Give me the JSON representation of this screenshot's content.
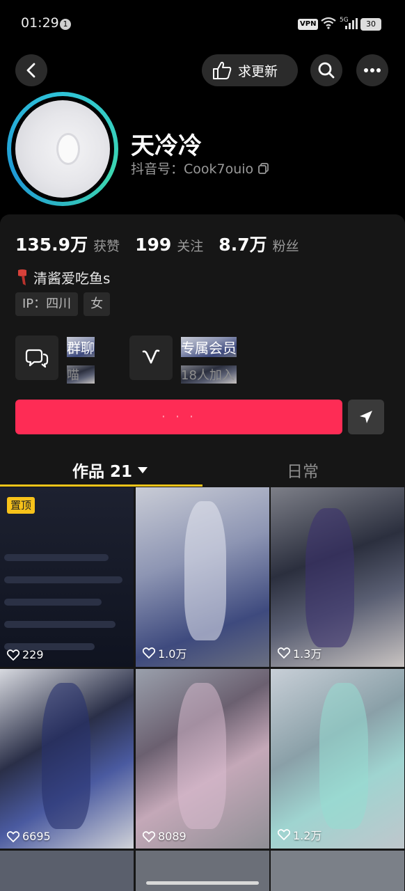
{
  "status_bar": {
    "time": "01:29",
    "notification_count": "1",
    "vpn": "VPN",
    "network": "5G",
    "battery": "30"
  },
  "nav": {
    "request_update_label": "求更新"
  },
  "profile": {
    "name": "天冷冷",
    "douyin_id": "抖音号：Cook7ouio",
    "stats": [
      {
        "value": "135.9万",
        "label": "获赞"
      },
      {
        "value": "199",
        "label": "关注"
      },
      {
        "value": "8.7万",
        "label": "粉丝"
      }
    ],
    "bio": "清酱爱吃鱼s",
    "tags": [
      "IP：四川",
      "女"
    ]
  },
  "features": {
    "group_chat": {
      "title": "群聊",
      "subtitle": "喵"
    },
    "membership": {
      "title": "专属会员",
      "subtitle": "18人加入"
    }
  },
  "follow_button_label": "· · ·",
  "tabs": {
    "works": "作品 21",
    "daily": "日常"
  },
  "videos": [
    {
      "likes": "229",
      "pinned": "置顶"
    },
    {
      "likes": "1.0万"
    },
    {
      "likes": "1.3万"
    },
    {
      "likes": "6695"
    },
    {
      "likes": "8089"
    },
    {
      "likes": "1.2万"
    }
  ],
  "colors": {
    "follow": "#fe2c55",
    "tab_indicator": "#f0c419",
    "avatar_ring": "#2fc4d8"
  }
}
